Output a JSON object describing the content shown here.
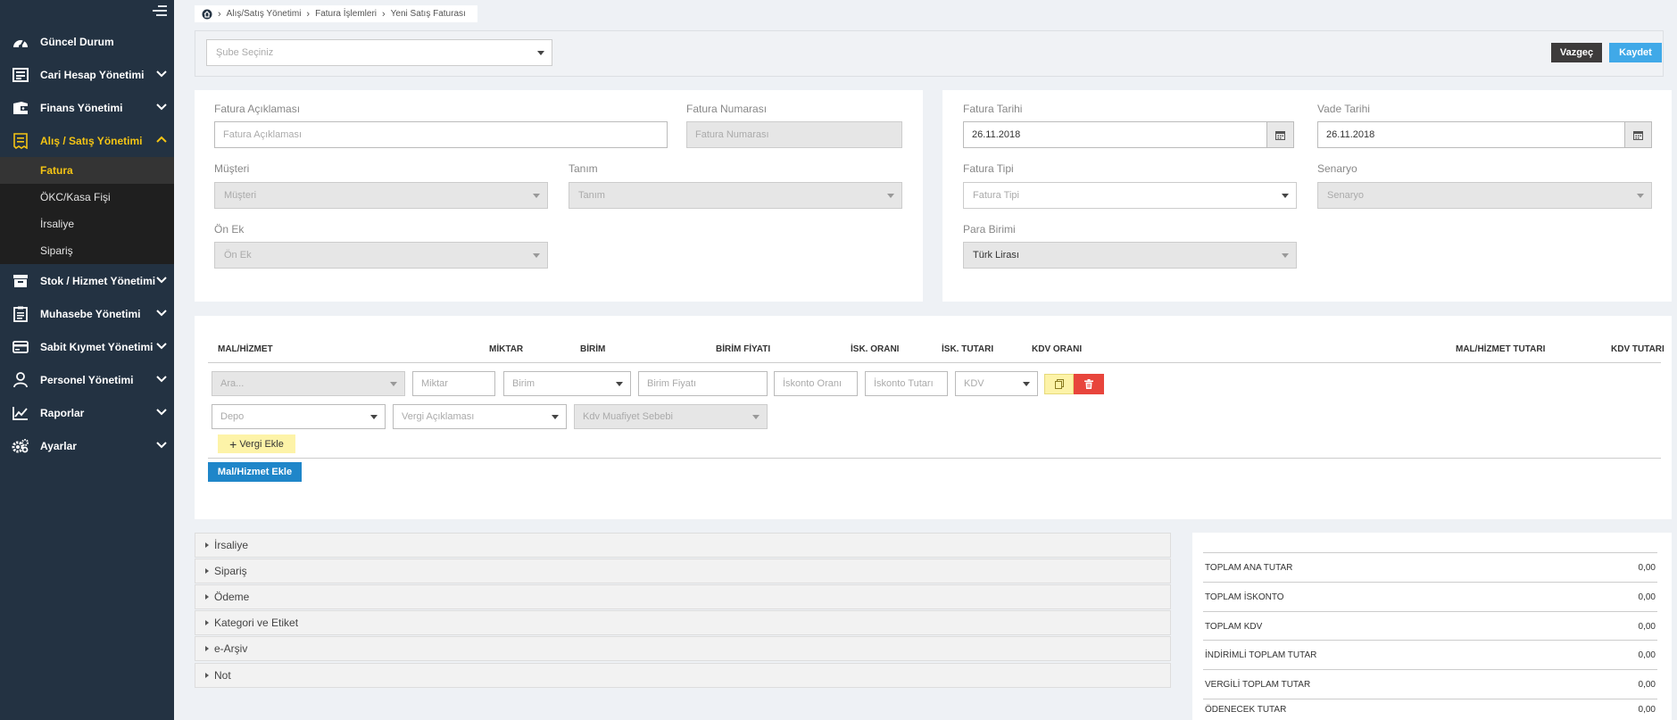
{
  "sidebar": {
    "items": [
      {
        "label": "Güncel Durum",
        "icon": "dashboard-icon",
        "expandable": false
      },
      {
        "label": "Cari Hesap Yönetimi",
        "icon": "ledger-icon",
        "expandable": true
      },
      {
        "label": "Finans Yönetimi",
        "icon": "finance-icon",
        "expandable": true
      },
      {
        "label": "Alış / Satış Yönetimi",
        "icon": "receipt-icon",
        "expandable": true,
        "active": true
      },
      {
        "label": "Stok / Hizmet Yönetimi",
        "icon": "box-icon",
        "expandable": true
      },
      {
        "label": "Muhasebe Yönetimi",
        "icon": "clipboard-icon",
        "expandable": true
      },
      {
        "label": "Sabit Kıymet Yönetimi",
        "icon": "card-icon",
        "expandable": true
      },
      {
        "label": "Personel Yönetimi",
        "icon": "user-icon",
        "expandable": true
      },
      {
        "label": "Raporlar",
        "icon": "chart-icon",
        "expandable": true
      },
      {
        "label": "Ayarlar",
        "icon": "gears-icon",
        "expandable": true
      }
    ],
    "subitems": [
      "Fatura",
      "ÖKC/Kasa Fişi",
      "İrsaliye",
      "Sipariş"
    ]
  },
  "breadcrumb": [
    "Alış/Satış Yönetimi",
    "Fatura İşlemleri",
    "Yeni Satış Faturası"
  ],
  "topbar": {
    "branch_placeholder": "Şube Seçiniz",
    "cancel": "Vazgeç",
    "save": "Kaydet"
  },
  "form_left": {
    "description_label": "Fatura Açıklaması",
    "description_placeholder": "Fatura Açıklaması",
    "number_label": "Fatura Numarası",
    "number_placeholder": "Fatura Numarası",
    "customer_label": "Müşteri",
    "customer_placeholder": "Müşteri",
    "definition_label": "Tanım",
    "definition_placeholder": "Tanım",
    "prefix_label": "Ön Ek",
    "prefix_placeholder": "Ön Ek"
  },
  "form_right": {
    "invoice_date_label": "Fatura Tarihi",
    "invoice_date": "26.11.2018",
    "due_date_label": "Vade Tarihi",
    "due_date": "26.11.2018",
    "invoice_type_label": "Fatura Tipi",
    "invoice_type_placeholder": "Fatura Tipi",
    "scenario_label": "Senaryo",
    "scenario_placeholder": "Senaryo",
    "currency_label": "Para Birimi",
    "currency": "Türk Lirası"
  },
  "items_table": {
    "headers": [
      "MAL/HİZMET",
      "MİKTAR",
      "BİRİM",
      "BİRİM FİYATI",
      "İSK. ORANI",
      "İSK. TUTARI",
      "KDV ORANI",
      "MAL/HİZMET TUTARI",
      "KDV TUTARI"
    ],
    "row": {
      "search": "Ara...",
      "quantity": "Miktar",
      "unit": "Birim",
      "unit_price": "Birim Fiyatı",
      "discount_rate": "İskonto Oranı",
      "discount_amount": "İskonto Tutarı",
      "vat": "KDV",
      "depot": "Depo",
      "tax_description": "Vergi Açıklaması",
      "vat_exemption": "Kdv Muafiyet Sebebi"
    },
    "add_tax": "Vergi Ekle",
    "add_item": "Mal/Hizmet Ekle"
  },
  "accordion": [
    "İrsaliye",
    "Sipariş",
    "Ödeme",
    "Kategori ve Etiket",
    "e-Arşiv",
    "Not"
  ],
  "totals": [
    {
      "label": "TOPLAM ANA TUTAR",
      "value": "0,00"
    },
    {
      "label": "TOPLAM İSKONTO",
      "value": "0,00"
    },
    {
      "label": "TOPLAM KDV",
      "value": "0,00"
    },
    {
      "label": "İNDİRİMLİ TOPLAM TUTAR",
      "value": "0,00"
    },
    {
      "label": "VERGİLİ TOPLAM TUTAR",
      "value": "0,00"
    },
    {
      "label": "ÖDENECEK TUTAR",
      "value": "0,00"
    }
  ],
  "colors": {
    "sidebar_bg": "#233242",
    "active_accent": "#f4c414",
    "save_button": "#40a9e8",
    "cancel_button": "#3d3b3b",
    "add_item_button": "#1f86c9",
    "delete_button": "#e8453c",
    "add_tax_button": "#fdf3a8"
  }
}
